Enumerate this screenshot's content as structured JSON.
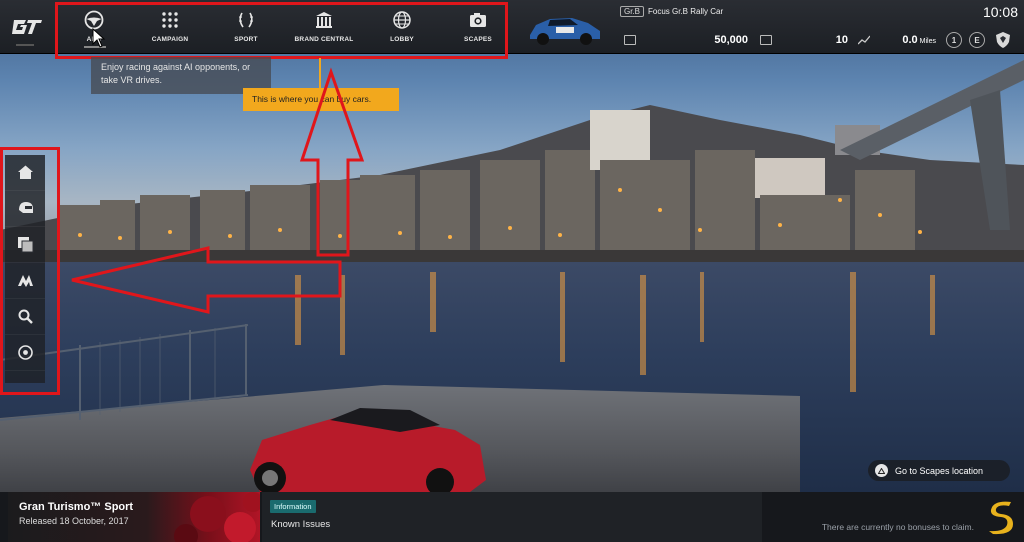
{
  "nav": {
    "items": [
      {
        "label": "ARCADE",
        "icon": "steering-wheel-icon"
      },
      {
        "label": "CAMPAIGN",
        "icon": "grid-dots-icon"
      },
      {
        "label": "SPORT",
        "icon": "laurel-icon"
      },
      {
        "label": "BRAND CENTRAL",
        "icon": "building-icon"
      },
      {
        "label": "LOBBY",
        "icon": "globe-icon"
      },
      {
        "label": "SCAPES",
        "icon": "camera-icon"
      }
    ],
    "arcade_visible": "ARC"
  },
  "car": {
    "class": "Gr.B",
    "name": "Focus Gr.B Rally Car"
  },
  "stats": {
    "credits": "50,000",
    "level": "10",
    "mileage": "0.0",
    "mileage_unit": "Miles",
    "rank": "1",
    "rating": "E"
  },
  "clock": "10:08",
  "tooltips": {
    "arcade_hint": "Enjoy racing against AI opponents, or take VR drives.",
    "brand_central_hint": "This is where you can buy cars."
  },
  "sidebar": {
    "items": [
      {
        "icon": "home-icon"
      },
      {
        "icon": "helmet-icon"
      },
      {
        "icon": "gallery-icon"
      },
      {
        "icon": "gt-mark-icon"
      },
      {
        "icon": "search-icon"
      },
      {
        "icon": "record-icon"
      }
    ]
  },
  "scapes_hint": "Go to Scapes location",
  "bottom": {
    "promo_title": "Gran Turismo™ Sport",
    "promo_date": "Released 18 October, 2017",
    "info_badge": "Information",
    "info_text": "Known Issues",
    "bonus_text": "There are currently no bonuses to claim."
  },
  "colors": {
    "annotation_red": "#e0161b",
    "tooltip_yellow": "#f2a81d",
    "info_teal": "#1a6b6e"
  }
}
